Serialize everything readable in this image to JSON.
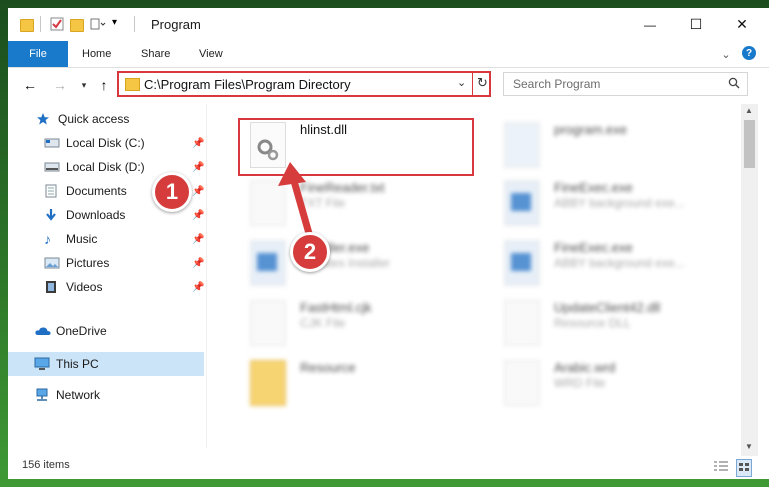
{
  "window": {
    "title": "Program",
    "controls": {
      "minimize": "—",
      "maximize": "☐",
      "close": "✕"
    }
  },
  "ribbon": {
    "tabs": [
      "File",
      "Home",
      "Share",
      "View"
    ]
  },
  "address": {
    "path": "C:\\Program Files\\Program Directory",
    "search_placeholder": "Search Program"
  },
  "nav": {
    "items": [
      {
        "label": "Quick access",
        "pinned": false
      },
      {
        "label": "Local Disk (C:)",
        "pinned": true
      },
      {
        "label": "Local Disk (D:)",
        "pinned": true
      },
      {
        "label": "Documents",
        "pinned": true
      },
      {
        "label": "Downloads",
        "pinned": true
      },
      {
        "label": "Music",
        "pinned": true
      },
      {
        "label": "Pictures",
        "pinned": true
      },
      {
        "label": "Videos",
        "pinned": true
      },
      {
        "label": "OneDrive",
        "pinned": false
      },
      {
        "label": "This PC",
        "pinned": false,
        "selected": true
      },
      {
        "label": "Network",
        "pinned": false
      }
    ]
  },
  "files": {
    "highlighted": {
      "name": "hlinst.dll"
    },
    "others": [
      {
        "name": "program.exe",
        "type": ""
      },
      {
        "name": "FineReader.txt",
        "type": "TXT File"
      },
      {
        "name": "FineExec.exe",
        "type": "ABBY background exe..."
      },
      {
        "name": "Installer.exe",
        "type": "Updates Installer"
      },
      {
        "name": "FineExec.exe",
        "type": "ABBY background exe..."
      },
      {
        "name": "FastHtml.cjk",
        "type": "CJK File"
      },
      {
        "name": "UpdateClient42.dll",
        "type": "Resource DLL"
      },
      {
        "name": "Resource",
        "type": ""
      },
      {
        "name": "Arabic.wrd",
        "type": "WRD File"
      }
    ]
  },
  "annotations": {
    "step1": "1",
    "step2": "2"
  },
  "status": {
    "item_count": "156 items"
  },
  "colors": {
    "accent": "#1979ca",
    "highlight": "#d9373e",
    "selected": "#cce4f7"
  }
}
